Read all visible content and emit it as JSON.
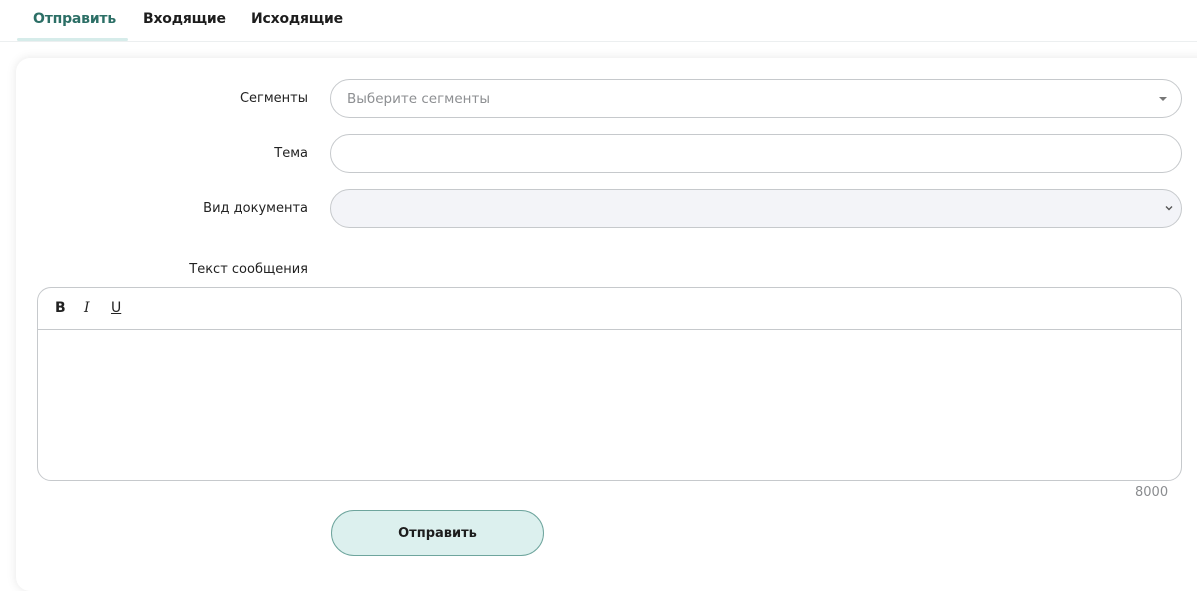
{
  "tabs": [
    {
      "label": "Отправить",
      "active": true
    },
    {
      "label": "Входящие",
      "active": false
    },
    {
      "label": "Исходящие",
      "active": false
    }
  ],
  "form": {
    "segments_label": "Сегменты",
    "segments_placeholder": "Выберите сегменты",
    "subject_label": "Тема",
    "subject_value": "",
    "doc_type_label": "Вид документа",
    "doc_type_value": "",
    "message_label": "Текст сообщения",
    "message_value": "",
    "char_counter": "8000",
    "submit_label": "Отправить"
  },
  "editor_toolbar": {
    "bold": "B",
    "italic": "I",
    "underline": "U"
  },
  "colors": {
    "accent": "#2c6f66",
    "button_bg": "#dcf0ee",
    "button_border": "#6ea59d"
  }
}
